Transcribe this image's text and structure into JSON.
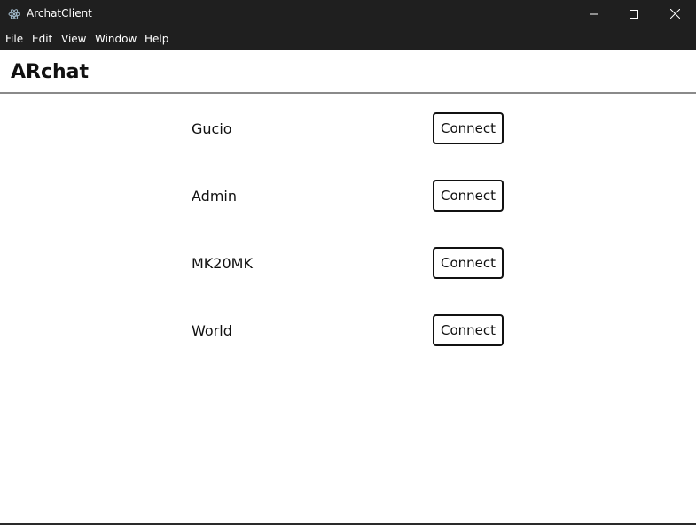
{
  "window": {
    "title": "ArchatClient"
  },
  "menu": {
    "items": [
      "File",
      "Edit",
      "View",
      "Window",
      "Help"
    ]
  },
  "header": {
    "title": "ARchat"
  },
  "contacts": [
    {
      "name": "Gucio",
      "action": "Connect"
    },
    {
      "name": "Admin",
      "action": "Connect"
    },
    {
      "name": "MK20MK",
      "action": "Connect"
    },
    {
      "name": "World",
      "action": "Connect"
    }
  ],
  "icons": {
    "app": "electron-atom-icon",
    "minimize": "minimize-icon",
    "maximize": "maximize-icon",
    "close": "close-icon"
  },
  "colors": {
    "titlebar_bg": "#1f1f1f",
    "titlebar_text": "#ffffff",
    "content_bg": "#ffffff",
    "text": "#111111",
    "rule": "#8a8a8a"
  }
}
